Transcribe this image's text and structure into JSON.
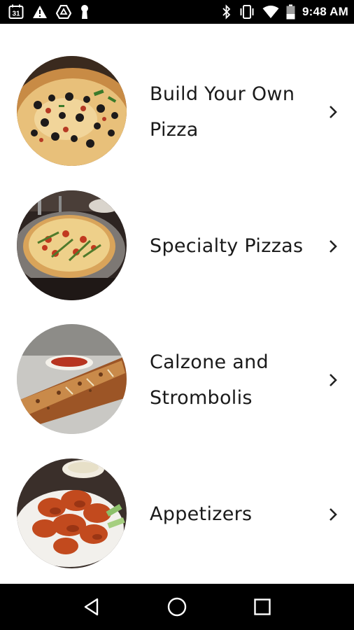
{
  "status_bar": {
    "time": "9:48 AM",
    "calendar_day": "31",
    "left_icons": [
      "calendar-icon",
      "warning-icon",
      "drive-icon",
      "keyhole-icon"
    ],
    "right_icons": [
      "bluetooth-icon",
      "vibrate-icon",
      "wifi-icon",
      "battery-icon"
    ]
  },
  "menu": {
    "items": [
      {
        "label_line1": "Build Your Own",
        "label_line2": "Pizza",
        "image": "pizza-olives-image",
        "chevron": "chevron-right-icon"
      },
      {
        "label_line1": "Specialty Pizzas",
        "label_line2": "",
        "image": "specialty-pizza-image",
        "chevron": "chevron-right-icon"
      },
      {
        "label_line1": "Calzone and",
        "label_line2": "Strombolis",
        "image": "stromboli-image",
        "chevron": "chevron-right-icon"
      },
      {
        "label_line1": "Appetizers",
        "label_line2": "",
        "image": "wings-image",
        "chevron": "chevron-right-icon"
      }
    ]
  },
  "nav_bar": {
    "buttons": [
      "back-icon",
      "home-icon",
      "recents-icon"
    ]
  }
}
